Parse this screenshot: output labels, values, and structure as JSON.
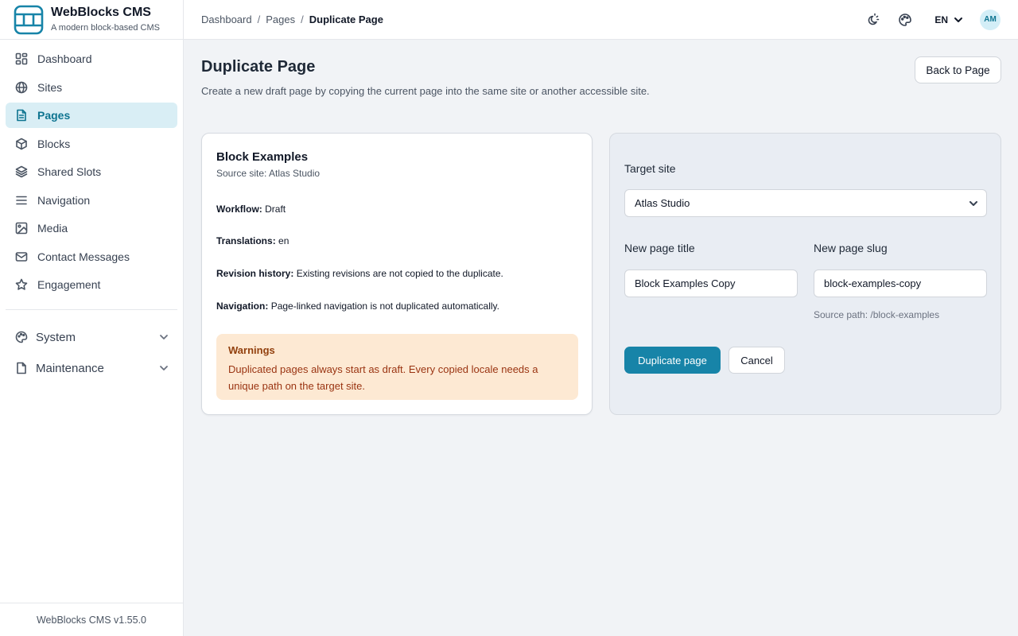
{
  "brand": {
    "name": "WebBlocks CMS",
    "tagline": "A modern block-based CMS",
    "version": "WebBlocks CMS v1.55.0"
  },
  "sidebar": {
    "items": [
      {
        "label": "Dashboard",
        "icon": "dashboard-icon"
      },
      {
        "label": "Sites",
        "icon": "globe-icon"
      },
      {
        "label": "Pages",
        "icon": "document-icon",
        "active": true
      },
      {
        "label": "Blocks",
        "icon": "cube-icon"
      },
      {
        "label": "Shared Slots",
        "icon": "layers-icon"
      },
      {
        "label": "Navigation",
        "icon": "menu-icon"
      },
      {
        "label": "Media",
        "icon": "image-icon"
      },
      {
        "label": "Contact Messages",
        "icon": "mail-icon"
      },
      {
        "label": "Engagement",
        "icon": "star-icon"
      }
    ],
    "groups": [
      {
        "label": "System",
        "icon": "palette-icon"
      },
      {
        "label": "Maintenance",
        "icon": "file-icon"
      }
    ]
  },
  "topbar": {
    "breadcrumb": [
      "Dashboard",
      "Pages",
      "Duplicate Page"
    ],
    "separator": "/",
    "language": "EN",
    "avatar_initials": "AM"
  },
  "header": {
    "title": "Duplicate Page",
    "subtitle": "Create a new draft page by copying the current page into the same site or another accessible site.",
    "back_button": "Back to Page"
  },
  "source": {
    "title": "Block Examples",
    "source_site": "Source site: Atlas Studio",
    "meta": [
      {
        "label": "Workflow:",
        "value": "Draft"
      },
      {
        "label": "Translations:",
        "value": "en"
      },
      {
        "label": "Revision history:",
        "value": "Existing revisions are not copied to the duplicate."
      },
      {
        "label": "Navigation:",
        "value": "Page-linked navigation is not duplicated automatically."
      }
    ],
    "warnings_title": "Warnings",
    "warnings_text": "Duplicated pages always start as draft. Every copied locale needs a unique path on the target site."
  },
  "form": {
    "target_site_label": "Target site",
    "target_site_value": "Atlas Studio",
    "title_label": "New page title",
    "title_value": "Block Examples Copy",
    "slug_label": "New page slug",
    "slug_value": "block-examples-copy",
    "source_path": "Source path: /block-examples",
    "submit_label": "Duplicate page",
    "cancel_label": "Cancel"
  },
  "colors": {
    "accent": "#1784a8",
    "active_nav_bg": "#d9eef5",
    "warning_bg": "#fde9d3",
    "warning_text": "#9a3412"
  }
}
